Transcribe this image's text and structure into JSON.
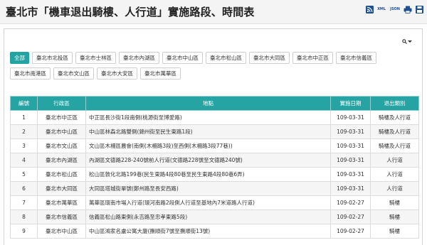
{
  "page": {
    "title": "臺北市「機車退出騎樓、人行道」實施路段、時間表"
  },
  "toolbar": {
    "rss_icon": "rss-icon",
    "xml_label": "XML",
    "json_label": "JSON",
    "print_icon": "print-icon",
    "save_icon": "save-icon"
  },
  "filters": {
    "row1": [
      "全部",
      "臺北市北投區",
      "臺北市士林區",
      "臺北市內湖區",
      "臺北市中山區",
      "臺北市松山區",
      "臺北市大同區",
      "臺北市中正區",
      "臺北市信義區"
    ],
    "row2": [
      "臺北市南港區",
      "臺北市文山區",
      "臺北市大安區",
      "臺北市萬華區"
    ],
    "active": "全部"
  },
  "table": {
    "headers": [
      "編號",
      "行政區",
      "地點",
      "實施日期",
      "退出類別"
    ],
    "rows": [
      [
        "1",
        "臺北市中正區",
        "中正區長沙街1段南側(桃源街至博愛路)",
        "109-03-31",
        "騎樓及人行道"
      ],
      [
        "2",
        "臺北市中山區",
        "中山區林森北路雙側(錦州街至民生東路1段)",
        "109-03-31",
        "騎樓及人行道"
      ],
      [
        "3",
        "臺北市文山區",
        "文山區木柵區農會(南側(木柵路3段)至西側(木柵路3段77巷))",
        "109-03-31",
        "騎樓及人行道"
      ],
      [
        "4",
        "臺北市內湖區",
        "內湖區文德路228-240號前人行道(文德路228號至文德路240號)",
        "109-03-31",
        "人行道"
      ],
      [
        "5",
        "臺北市松山區",
        "松山區敦化北路199巷(民生東路4段80巷至民生東路4段80巷6弄)",
        "109-03-31",
        "人行道"
      ],
      [
        "6",
        "臺北市大同區",
        "大同區塔城街單號(鄭州路至長安西路)",
        "109-03-31",
        "人行道"
      ],
      [
        "7",
        "臺北市萬華區",
        "萬華區環南市場入行道(環河南路2段側人行道至基地內7米道路人行道)",
        "109-02-27",
        "騎樓"
      ],
      [
        "8",
        "臺北市信義區",
        "信義區松山路東側(永吉路至忠孝東路5段)",
        "109-02-27",
        "騎樓"
      ],
      [
        "9",
        "臺北市中山區",
        "中山區鴻家名盧公寓大廈(撫順街7號至撫順街13號)",
        "109-02-27",
        "騎樓"
      ]
    ]
  },
  "colors": {
    "accent": "#26a3a3",
    "header_bg": "#f4f4f4"
  }
}
